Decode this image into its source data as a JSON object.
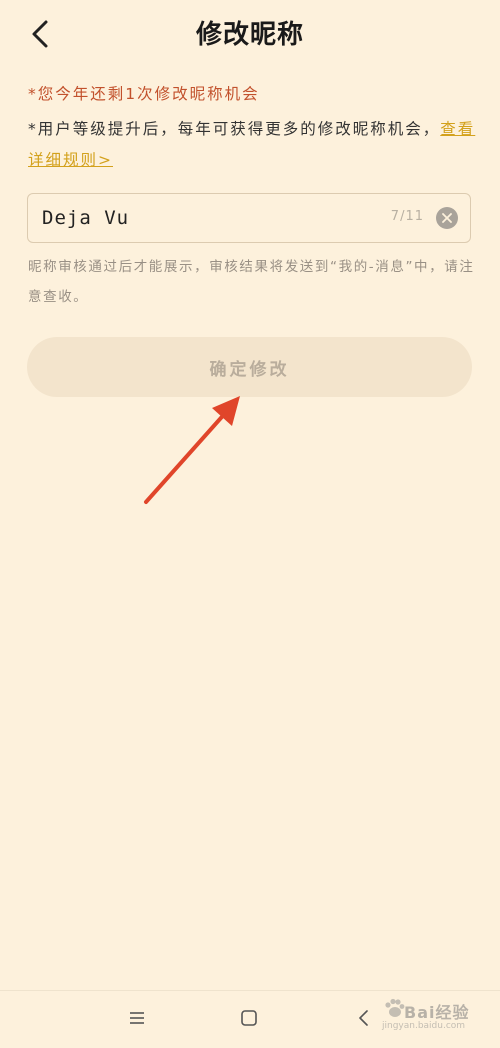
{
  "header": {
    "title": "修改昵称"
  },
  "notices": {
    "remaining": "*您今年还剩1次修改昵称机会",
    "upgrade": "*用户等级提升后，每年可获得更多的修改昵称机会，",
    "rules_link": "查看详细规则>"
  },
  "nickname": {
    "value": "Deja Vu",
    "count": "7/11"
  },
  "hint": "昵称审核通过后才能展示，审核结果将发送到“我的-消息”中，请注意查收。",
  "confirm": {
    "label": "确定修改"
  },
  "watermark": {
    "text": "Bai经验",
    "sub": "jingyan.baidu.com"
  },
  "colors": {
    "background": "#fdf1dc",
    "accent_red": "#c2512c",
    "link_gold": "#d3a11c",
    "arrow": "#e0452a"
  }
}
